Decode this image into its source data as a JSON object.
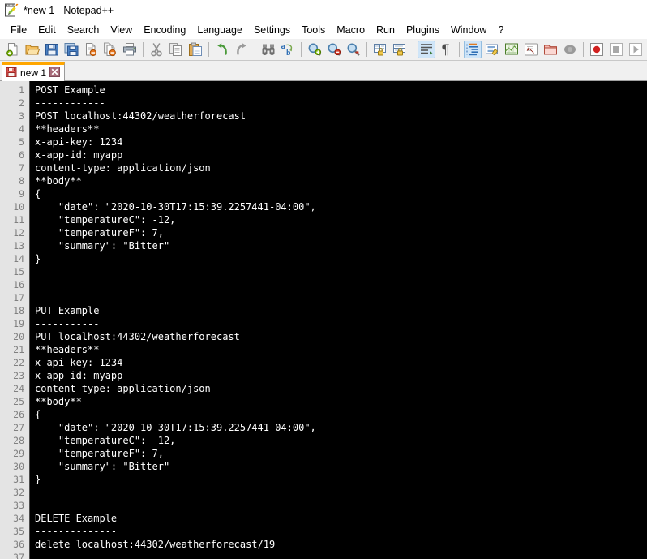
{
  "window": {
    "title": "*new 1 - Notepad++",
    "app_icon": "notepad-plus-plus-icon"
  },
  "menubar": {
    "items": [
      {
        "label": "File",
        "name": "menu-file"
      },
      {
        "label": "Edit",
        "name": "menu-edit"
      },
      {
        "label": "Search",
        "name": "menu-search"
      },
      {
        "label": "View",
        "name": "menu-view"
      },
      {
        "label": "Encoding",
        "name": "menu-encoding"
      },
      {
        "label": "Language",
        "name": "menu-language"
      },
      {
        "label": "Settings",
        "name": "menu-settings"
      },
      {
        "label": "Tools",
        "name": "menu-tools"
      },
      {
        "label": "Macro",
        "name": "menu-macro"
      },
      {
        "label": "Run",
        "name": "menu-run"
      },
      {
        "label": "Plugins",
        "name": "menu-plugins"
      },
      {
        "label": "Window",
        "name": "menu-window"
      },
      {
        "label": "?",
        "name": "menu-help"
      }
    ]
  },
  "toolbar": {
    "buttons": [
      "new-file-icon",
      "open-file-icon",
      "save-icon",
      "save-all-icon",
      "close-file-icon",
      "close-all-icon",
      "print-icon",
      "cut-icon",
      "copy-icon",
      "paste-icon",
      "undo-icon",
      "redo-icon",
      "find-icon",
      "replace-icon",
      "zoom-in-icon",
      "zoom-out-icon",
      "zoom-restore-icon",
      "sync-vertical-scroll-icon",
      "sync-horizontal-scroll-icon",
      "word-wrap-icon",
      "show-all-characters-icon",
      "indent-guide-icon",
      "user-defined-language-icon",
      "show-document-map-icon",
      "function-list-icon",
      "folder-as-workspace-icon",
      "monitoring-icon",
      "macro-record-icon",
      "macro-stop-icon",
      "macro-play-icon",
      "macro-run-multiple-icon",
      "macro-save-icon"
    ],
    "toggled": [
      "word-wrap-icon",
      "indent-guide-icon"
    ]
  },
  "tabs": [
    {
      "label": "new 1",
      "icon": "unsaved-file-icon",
      "close": "close-tab-icon",
      "active": true
    }
  ],
  "editor": {
    "colors": {
      "background": "#000000",
      "text": "#ffffff",
      "gutter_background": "#e4e4e4",
      "gutter_text": "#808080",
      "tab_accent": "#ffa600"
    },
    "first_line_number": 1,
    "lines": [
      "POST Example",
      "------------",
      "POST localhost:44302/weatherforecast",
      "**headers**",
      "x-api-key: 1234",
      "x-app-id: myapp",
      "content-type: application/json",
      "**body**",
      "{",
      "    \"date\": \"2020-10-30T17:15:39.2257441-04:00\",",
      "    \"temperatureC\": -12,",
      "    \"temperatureF\": 7,",
      "    \"summary\": \"Bitter\"",
      "}",
      "",
      "",
      "",
      "PUT Example",
      "-----------",
      "PUT localhost:44302/weatherforecast",
      "**headers**",
      "x-api-key: 1234",
      "x-app-id: myapp",
      "content-type: application/json",
      "**body**",
      "{",
      "    \"date\": \"2020-10-30T17:15:39.2257441-04:00\",",
      "    \"temperatureC\": -12,",
      "    \"temperatureF\": 7,",
      "    \"summary\": \"Bitter\"",
      "}",
      "",
      "",
      "DELETE Example",
      "--------------",
      "delete localhost:44302/weatherforecast/19",
      ""
    ]
  }
}
